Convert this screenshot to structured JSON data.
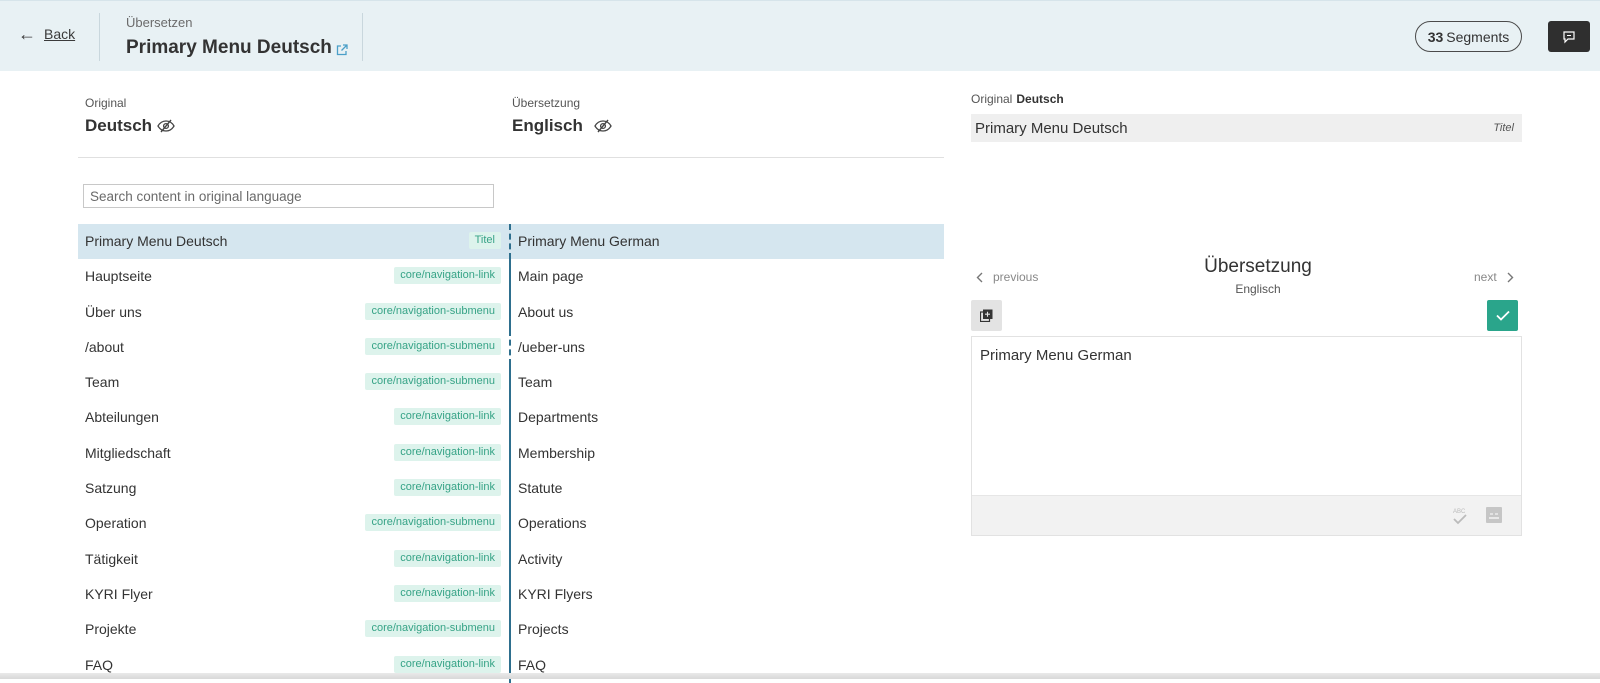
{
  "header": {
    "back_label": "Back",
    "subtitle": "Übersetzen",
    "title": "Primary Menu Deutsch",
    "segments_count": "33",
    "segments_label": "Segments"
  },
  "columns": {
    "original_label": "Original",
    "original_lang": "Deutsch",
    "translation_label": "Übersetzung",
    "translation_lang": "Englisch"
  },
  "search": {
    "placeholder": "Search content in original language"
  },
  "segments": [
    {
      "source": "Primary Menu Deutsch",
      "tag": "Titel",
      "target": "Primary Menu German"
    },
    {
      "source": "Hauptseite",
      "tag": "core/navigation-link",
      "target": "Main page"
    },
    {
      "source": "Über uns",
      "tag": "core/navigation-submenu",
      "target": "About us"
    },
    {
      "source": "/about",
      "tag": "core/navigation-submenu",
      "target": "/ueber-uns"
    },
    {
      "source": "Team",
      "tag": "core/navigation-submenu",
      "target": "Team"
    },
    {
      "source": "Abteilungen",
      "tag": "core/navigation-link",
      "target": "Departments"
    },
    {
      "source": "Mitgliedschaft",
      "tag": "core/navigation-link",
      "target": "Membership"
    },
    {
      "source": "Satzung",
      "tag": "core/navigation-link",
      "target": "Statute"
    },
    {
      "source": "Operation",
      "tag": "core/navigation-submenu",
      "target": "Operations"
    },
    {
      "source": "Tätigkeit",
      "tag": "core/navigation-link",
      "target": "Activity"
    },
    {
      "source": "KYRI Flyer",
      "tag": "core/navigation-link",
      "target": "KYRI Flyers"
    },
    {
      "source": "Projekte",
      "tag": "core/navigation-submenu",
      "target": "Projects"
    },
    {
      "source": "FAQ",
      "tag": "core/navigation-link",
      "target": "FAQ"
    }
  ],
  "panel": {
    "original_label": "Original",
    "original_lang": "Deutsch",
    "original_text": "Primary Menu Deutsch",
    "original_type": "Titel",
    "previous_label": "previous",
    "next_label": "next",
    "translation_title": "Übersetzung",
    "translation_lang": "Englisch",
    "translation_text": "Primary Menu German"
  },
  "colors": {
    "header_bg": "#e8f1f4",
    "active_row": "#d5e6ef",
    "accent_green": "#2aa58b",
    "tag_text": "#36a386",
    "tag_bg": "#ddf3ec"
  }
}
